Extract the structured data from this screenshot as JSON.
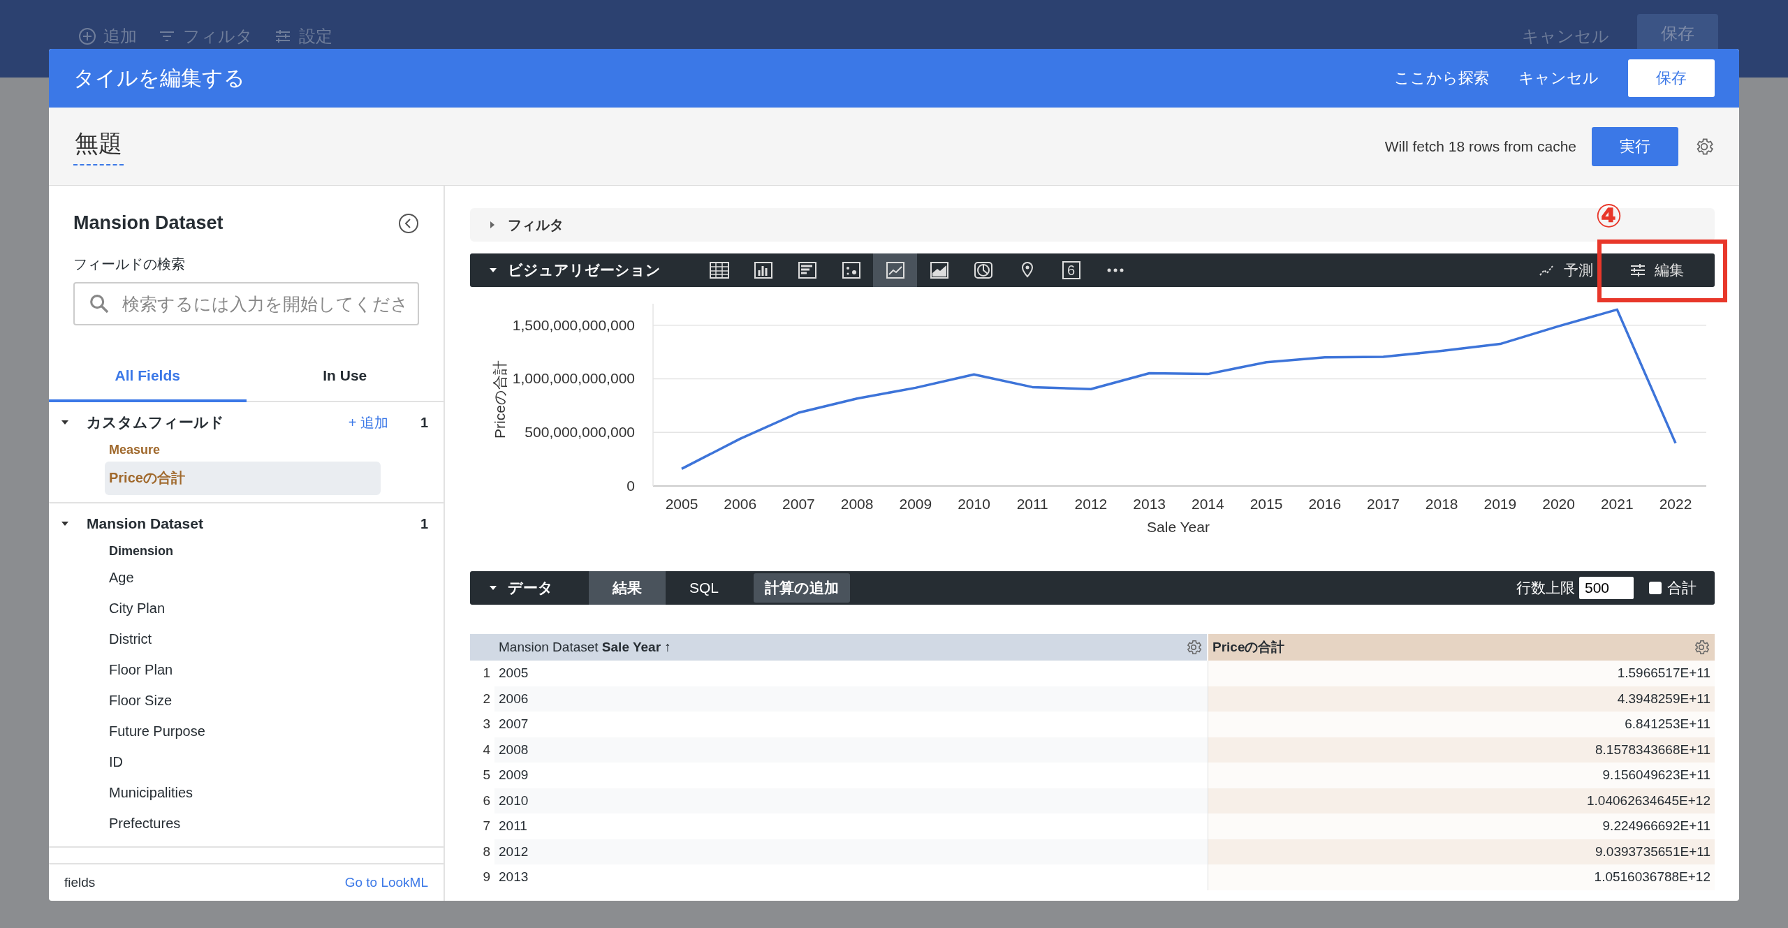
{
  "background_toolbar": {
    "left": [
      {
        "kind": "add",
        "label": "追加"
      },
      {
        "kind": "filter",
        "label": "フィルタ"
      },
      {
        "kind": "settings",
        "label": "設定"
      }
    ],
    "cancel": "キャンセル",
    "save": "保存"
  },
  "dialog": {
    "title": "タイルを編集する",
    "explore_link": "ここから探索",
    "cancel": "キャンセル",
    "save": "保存"
  },
  "tile_title": "無題",
  "cache_note": "Will fetch 18 rows from cache",
  "run_button": "実行",
  "sidebar": {
    "title": "Mansion Dataset",
    "search_label": "フィールドの検索",
    "search": {
      "placeholder": "検索するには入力を開始してくださ"
    },
    "tabs": [
      {
        "label": "All Fields",
        "selected": true
      },
      {
        "label": "In Use",
        "selected": false
      }
    ],
    "sections": [
      {
        "title": "カスタムフィールド",
        "expanded": true,
        "add_link": "+ 追加",
        "count": "1",
        "groups": [
          {
            "heading": "Measure",
            "kind": "measure",
            "items": [
              {
                "label": "Priceの合計",
                "selected": true
              }
            ]
          }
        ]
      },
      {
        "title": "Mansion Dataset",
        "expanded": true,
        "count": "1",
        "groups": [
          {
            "heading": "Dimension",
            "kind": "dimension",
            "items": [
              {
                "label": "Age",
                "selected": false
              },
              {
                "label": "City Plan",
                "selected": false
              },
              {
                "label": "District",
                "selected": false
              },
              {
                "label": "Floor Plan",
                "selected": false
              },
              {
                "label": "Floor Size",
                "selected": false
              },
              {
                "label": "Future Purpose",
                "selected": false
              },
              {
                "label": "ID",
                "selected": false
              },
              {
                "label": "Municipalities",
                "selected": false
              },
              {
                "label": "Prefectures",
                "selected": false
              }
            ]
          }
        ]
      }
    ],
    "footer_left": "fields",
    "footer_link": "Go to LookML"
  },
  "filter_bar": {
    "label": "フィルタ",
    "expanded": false
  },
  "visualization_bar": {
    "label": "ビジュアリゼーション",
    "expanded": true,
    "types": [
      {
        "kind": "table",
        "selected": false
      },
      {
        "kind": "column",
        "selected": false
      },
      {
        "kind": "bar",
        "selected": false
      },
      {
        "kind": "scatter",
        "selected": false
      },
      {
        "kind": "line",
        "selected": true
      },
      {
        "kind": "area",
        "selected": false
      },
      {
        "kind": "pie",
        "selected": false
      },
      {
        "kind": "map",
        "selected": false
      },
      {
        "kind": "single_value",
        "label": "6",
        "selected": false
      },
      {
        "kind": "more",
        "selected": false
      }
    ],
    "forecast": "予測",
    "edit": "編集"
  },
  "annotation": {
    "label": "④"
  },
  "chart_data": {
    "type": "line",
    "xlabel": "Sale Year",
    "ylabel": "Priceの合計",
    "categories": [
      "2005",
      "2006",
      "2007",
      "2008",
      "2009",
      "2010",
      "2011",
      "2012",
      "2013",
      "2014",
      "2015",
      "2016",
      "2017",
      "2018",
      "2019",
      "2020",
      "2021",
      "2022"
    ],
    "series": [
      {
        "color": "#3d74d9",
        "values": [
          160000000000,
          440000000000,
          684000000000,
          816000000000,
          916000000000,
          1041000000000,
          922000000000,
          904000000000,
          1052000000000,
          1045000000000,
          1155000000000,
          1200000000000,
          1205000000000,
          1260000000000,
          1325000000000,
          1490000000000,
          1645000000000,
          400000000000
        ]
      }
    ],
    "ylim": [
      0,
      1700000000000
    ],
    "grid": true,
    "yticks": [
      {
        "value": 0,
        "label": "0"
      },
      {
        "value": 500000000000,
        "label": "500,000,000,000"
      },
      {
        "value": 1000000000000,
        "label": "1,000,000,000,000"
      },
      {
        "value": 1500000000000,
        "label": "1,500,000,000,000"
      }
    ]
  },
  "data_bar": {
    "label": "データ",
    "expanded": true,
    "tabs": [
      {
        "label": "結果",
        "selected": true
      },
      {
        "label": "SQL",
        "selected": false
      }
    ],
    "add_calc": "計算の追加",
    "row_limit_label": "行数上限",
    "row_limit": "500",
    "totals": {
      "label": "合計",
      "checked": false
    }
  },
  "table": {
    "columns": [
      {
        "prefix": "Mansion Dataset",
        "name": "Sale Year ↑",
        "kind": "dimension"
      },
      {
        "name": "Priceの合計",
        "kind": "measure"
      }
    ],
    "rows": [
      {
        "index": "1",
        "cells": [
          "2005",
          "1.5966517E+11"
        ]
      },
      {
        "index": "2",
        "cells": [
          "2006",
          "4.3948259E+11"
        ]
      },
      {
        "index": "3",
        "cells": [
          "2007",
          "6.841253E+11"
        ]
      },
      {
        "index": "4",
        "cells": [
          "2008",
          "8.1578343668E+11"
        ]
      },
      {
        "index": "5",
        "cells": [
          "2009",
          "9.156049623E+11"
        ]
      },
      {
        "index": "6",
        "cells": [
          "2010",
          "1.04062634645E+12"
        ]
      },
      {
        "index": "7",
        "cells": [
          "2011",
          "9.224966692E+11"
        ]
      },
      {
        "index": "8",
        "cells": [
          "2012",
          "9.0393735651E+11"
        ]
      },
      {
        "index": "9",
        "cells": [
          "2013",
          "1.0516036788E+12"
        ]
      }
    ]
  }
}
